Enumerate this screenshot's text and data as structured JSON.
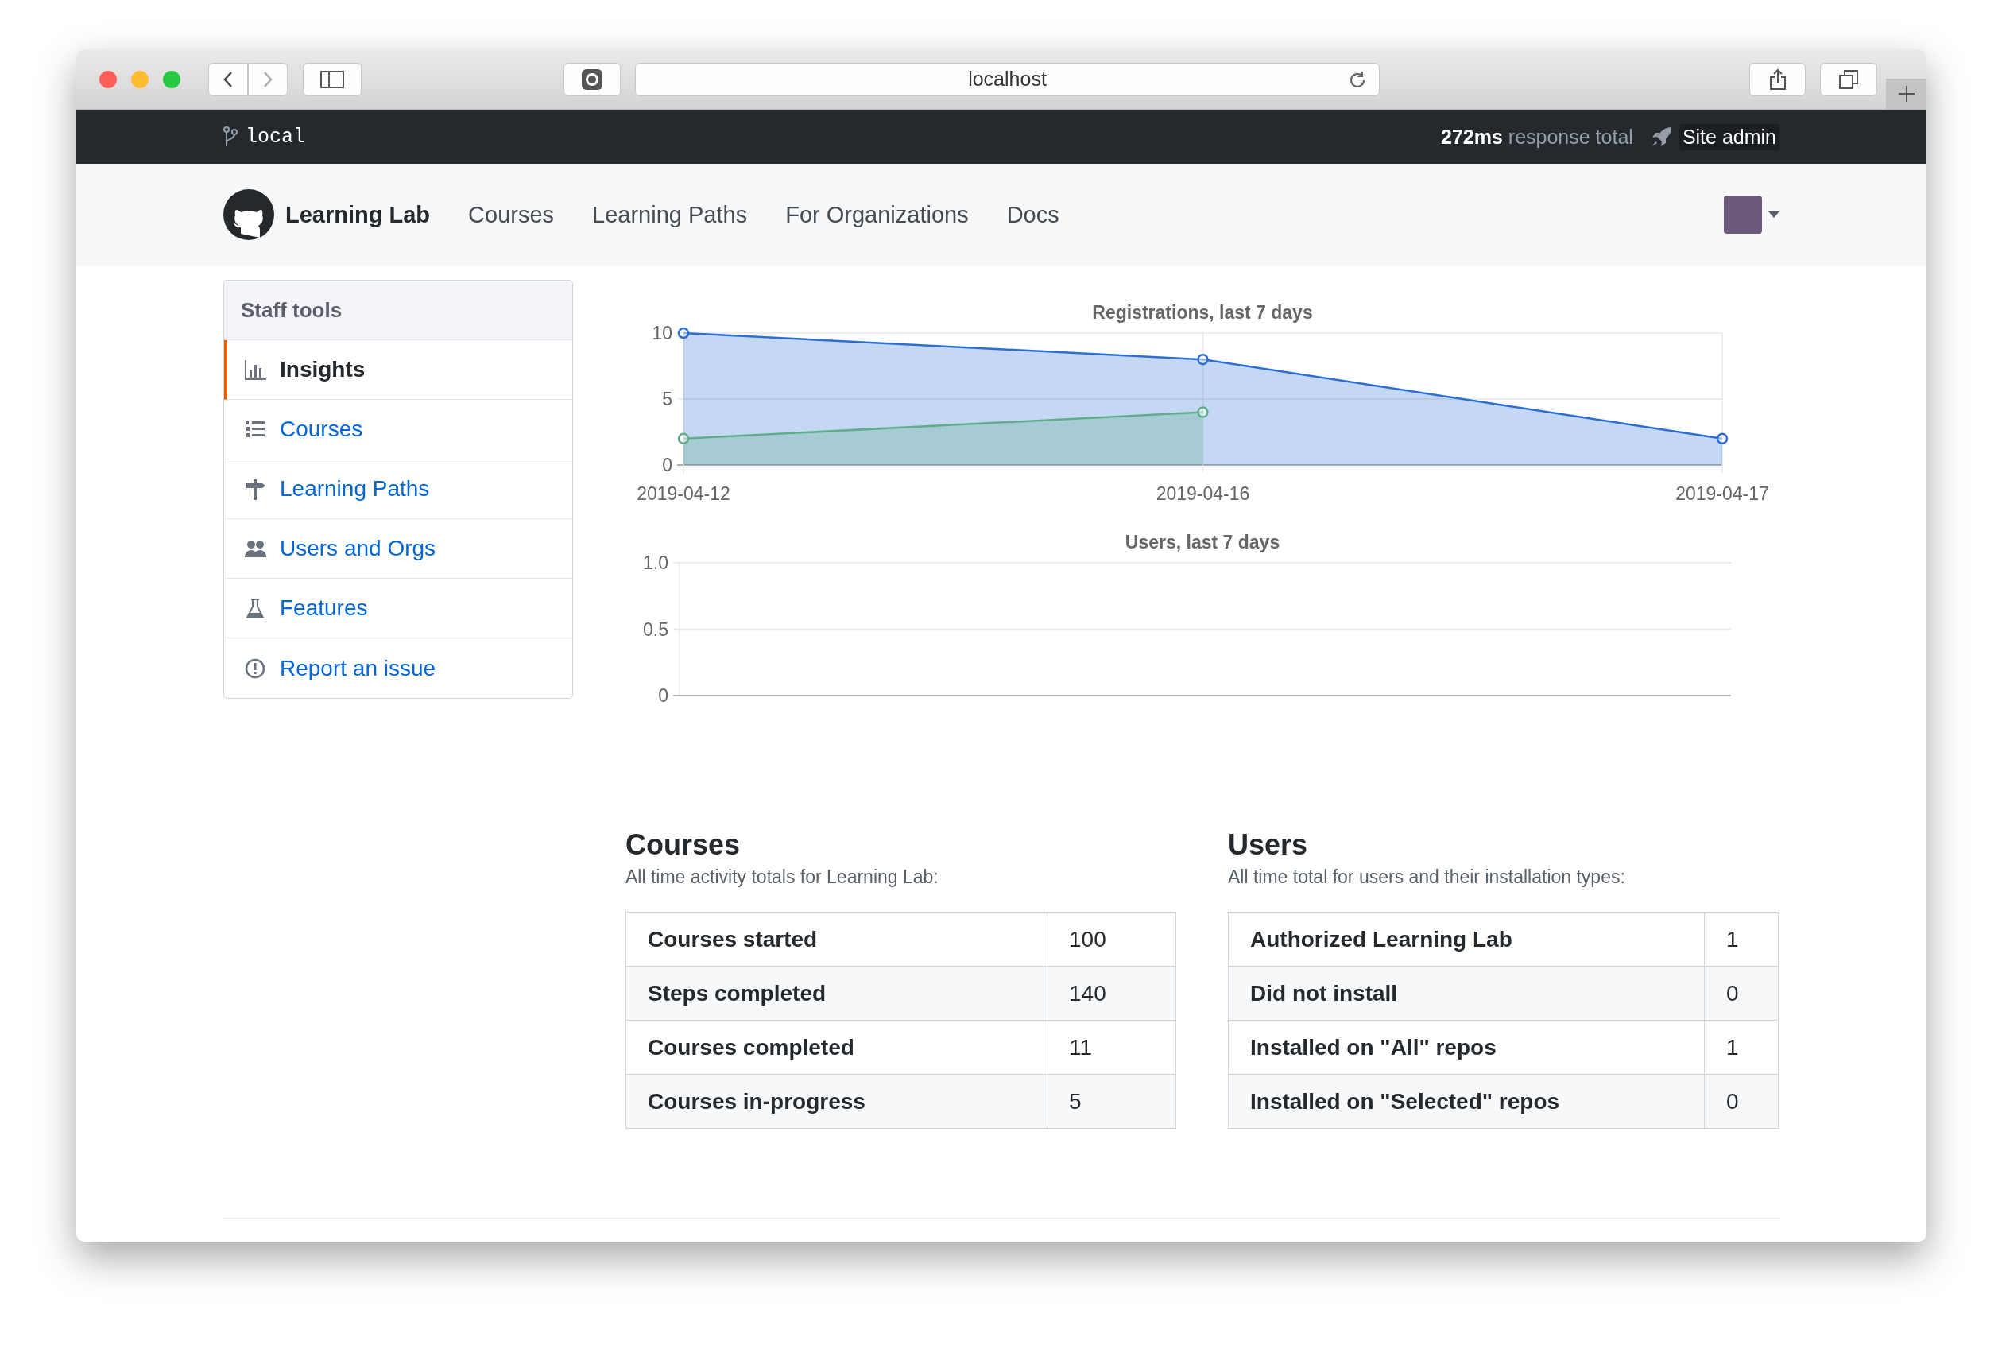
{
  "browser": {
    "url": "localhost"
  },
  "topbar": {
    "branch": "local",
    "timing": "**272ms** response total",
    "admin": "Site admin"
  },
  "nav": {
    "brand": "Learning Lab",
    "links": [
      "Courses",
      "Learning Paths",
      "For Organizations",
      "Docs"
    ]
  },
  "sidebar": {
    "title": "Staff tools",
    "items": [
      {
        "label": "Insights",
        "kind": "graph",
        "selected": true
      },
      {
        "label": "Courses",
        "kind": "list",
        "selected": false
      },
      {
        "label": "Learning Paths",
        "kind": "signpost",
        "selected": false
      },
      {
        "label": "Users and Orgs",
        "kind": "people",
        "selected": false
      },
      {
        "label": "Features",
        "kind": "beaker",
        "selected": false
      },
      {
        "label": "Report an issue",
        "kind": "alert",
        "selected": false
      }
    ]
  },
  "charts": [
    {
      "chart_data": {
        "type": "area",
        "grid": true,
        "title": "Registrations, last 7 days",
        "categories": [
          "2019-04-12",
          "2019-04-16",
          "2019-04-17"
        ],
        "ylim": [
          0,
          10
        ],
        "yticks": [
          0,
          5,
          10
        ],
        "series": [
          {
            "color": "#2c6ed5",
            "values": [
              10,
              8,
              2
            ]
          },
          {
            "color": "#5fae8a",
            "values": [
              2,
              4,
              null
            ]
          }
        ]
      }
    },
    {
      "title": "Users, last 7 days",
      "axis_labels": [
        "1.0",
        "0.5",
        "0"
      ]
    }
  ],
  "sections": [
    {
      "title": "Courses",
      "subtitle": "All time activity totals for Learning Lab:",
      "rows": [
        {
          "label": "Courses started",
          "value": "100"
        },
        {
          "label": "Steps completed",
          "value": "140"
        },
        {
          "label": "Courses completed",
          "value": "11"
        },
        {
          "label": "Courses in-progress",
          "value": "5"
        }
      ]
    },
    {
      "title": "Users",
      "subtitle": "All time total for users and their installation types:",
      "rows": [
        {
          "label": "Authorized Learning Lab",
          "value": "1"
        },
        {
          "label": "Did not install",
          "value": "0"
        },
        {
          "label": "Installed on \"All\" repos",
          "value": "1"
        },
        {
          "label": "Installed on \"Selected\" repos",
          "value": "0"
        }
      ]
    }
  ]
}
